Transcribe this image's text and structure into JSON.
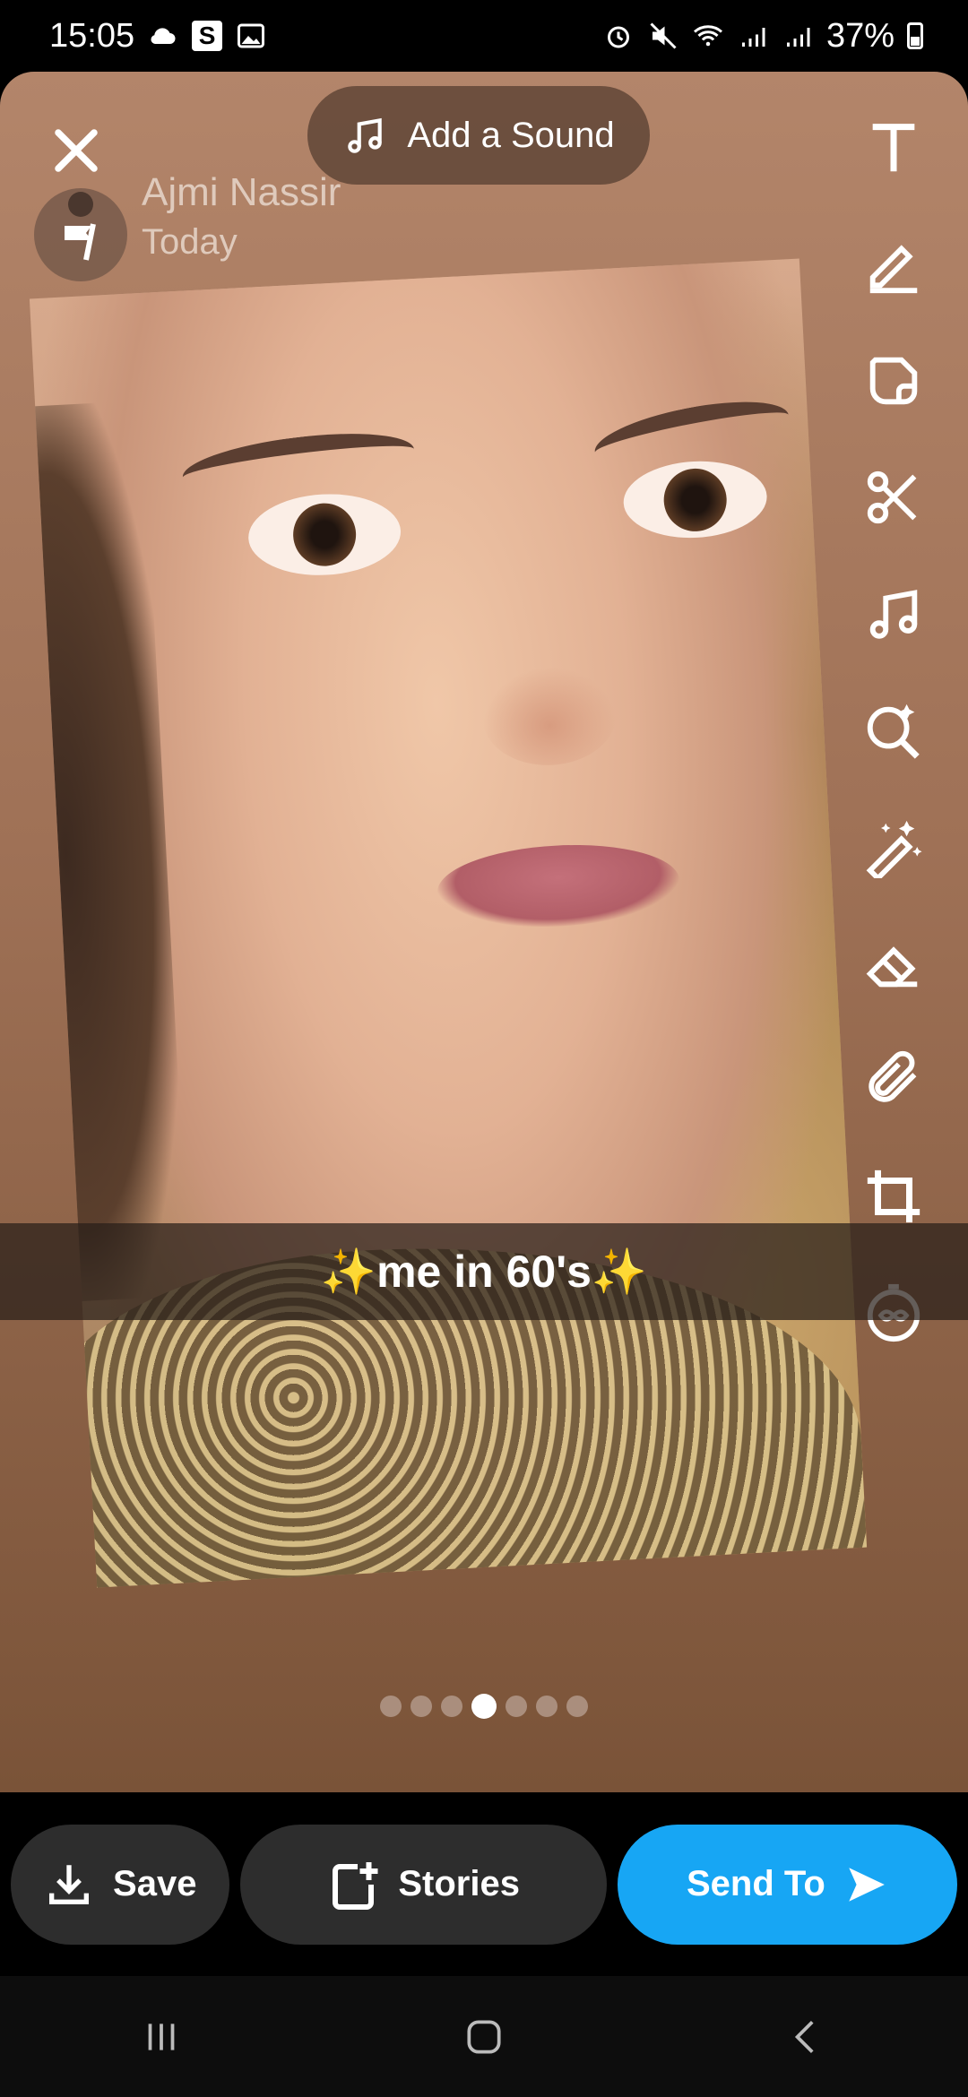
{
  "status_bar": {
    "time": "15:05",
    "left_icons": [
      "cloud-icon",
      "s-app-icon",
      "gallery-icon"
    ],
    "right_icons": [
      "alarm-icon",
      "mute-icon",
      "wifi-icon",
      "signal-icon",
      "signal-icon"
    ],
    "battery": "37%",
    "badge_s": "S"
  },
  "header": {
    "add_sound_label": "Add a Sound",
    "author_name": "Ajmi Nassir",
    "author_date": "Today"
  },
  "toolbar": {
    "tools": [
      "text-tool",
      "pencil-tool",
      "sticker-tool",
      "scissors-tool",
      "music-tool",
      "lens-search-tool",
      "magic-wand-tool",
      "eraser-tool",
      "attachment-tool",
      "crop-tool",
      "timer-tool"
    ]
  },
  "caption": {
    "text": "✨me in 60's✨"
  },
  "pager": {
    "count": 7,
    "active_index": 3
  },
  "actions": {
    "save_label": "Save",
    "stories_label": "Stories",
    "send_label": "Send To"
  },
  "colors": {
    "send_button": "#17a6f4",
    "pill_bg": "#2d2d2d",
    "canvas_bg": "#a67a5f"
  }
}
